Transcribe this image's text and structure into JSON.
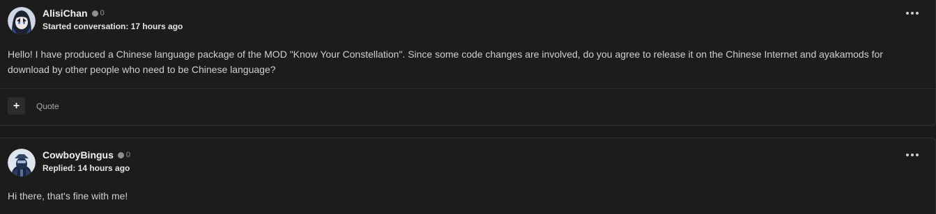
{
  "posts": [
    {
      "author": "AlisiChan",
      "status_count": "0",
      "meta": "Started conversation: 17 hours ago",
      "body": "Hello! I have produced a Chinese language package of the MOD \"Know Your Constellation\". Since some code changes are involved, do you agree to release it on the Chinese Internet and ayakamods for download by other people who need to be Chinese language?",
      "avatar_icon": "anime-girl-avatar",
      "more_icon": "more-dots-icon"
    },
    {
      "author": "CowboyBingus",
      "status_count": "0",
      "meta": "Replied: 14 hours ago",
      "body": "Hi there, that's fine with me!",
      "avatar_icon": "armored-figure-avatar",
      "more_icon": "more-dots-icon"
    }
  ],
  "actions": {
    "add_icon": "plus-icon",
    "add_label": "+",
    "quote_label": "Quote"
  },
  "colors": {
    "background": "#1b1b1b",
    "card": "#1c1c1c",
    "border": "#2f2f2f",
    "status_dot": "#8f8f8f"
  }
}
